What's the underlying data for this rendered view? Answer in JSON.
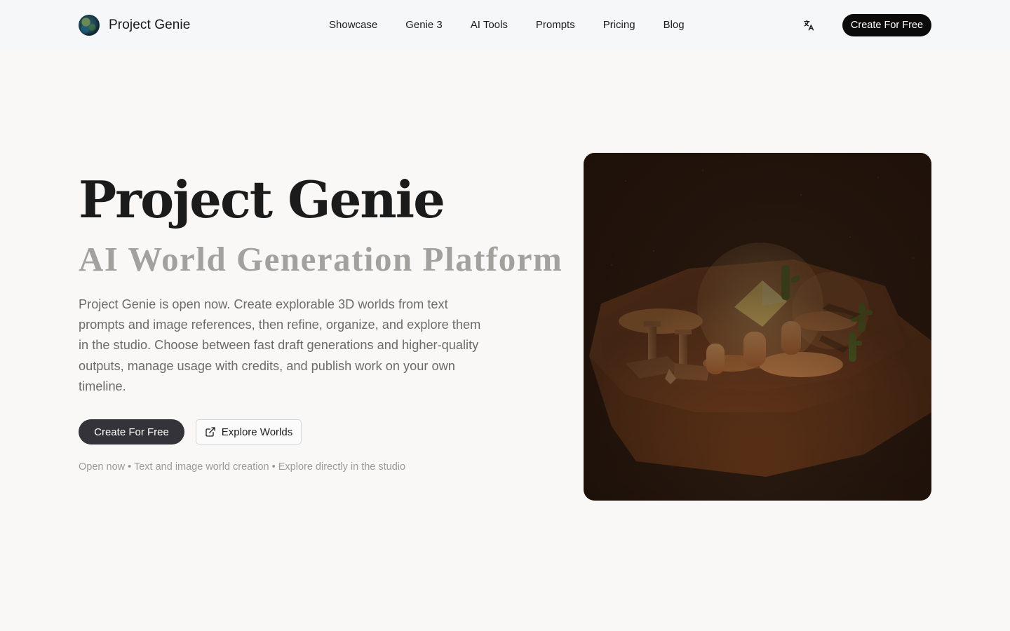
{
  "brand": {
    "name": "Project Genie",
    "logo_icon": "globe-icon"
  },
  "nav": {
    "items": [
      {
        "label": "Showcase"
      },
      {
        "label": "Genie 3"
      },
      {
        "label": "AI Tools"
      },
      {
        "label": "Prompts"
      },
      {
        "label": "Pricing"
      },
      {
        "label": "Blog"
      }
    ]
  },
  "header": {
    "language_icon": "translate-icon",
    "cta_label": "Create For Free"
  },
  "hero": {
    "title": "Project Genie",
    "subtitle": "AI World Generation Platform",
    "description": "Project Genie is open now. Create explorable 3D worlds from text prompts and image references, then refine, organize, and explore them in the studio. Choose between fast draft generations and higher-quality outputs, manage usage with credits, and publish work on your own timeline.",
    "primary_button": "Create For Free",
    "secondary_button": "Explore Worlds",
    "secondary_icon": "external-link-icon",
    "tagline": "Open now • Text and image world creation • Explore directly in the studio"
  },
  "colors": {
    "header_bg": "#f6f7f9",
    "page_bg": "#f9f8f6",
    "cta_bg": "#0b0b0b",
    "primary_button_bg": "#343339",
    "subtitle_color": "#a3a19d"
  }
}
